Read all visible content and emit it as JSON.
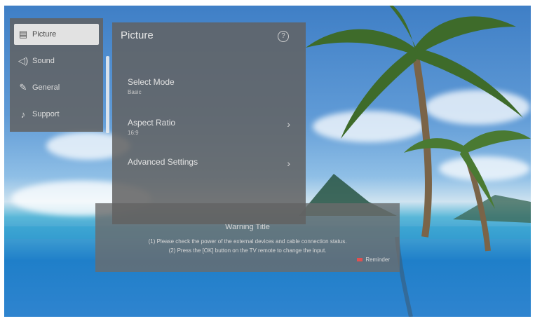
{
  "sidebar": {
    "items": [
      {
        "label": "Picture",
        "icon": "picture-icon",
        "glyph": "▤"
      },
      {
        "label": "Sound",
        "icon": "sound-icon",
        "glyph": "◁)"
      },
      {
        "label": "General",
        "icon": "wrench-icon",
        "glyph": "✎"
      },
      {
        "label": "Support",
        "icon": "headset-icon",
        "glyph": "♪"
      }
    ],
    "active_index": 0
  },
  "panel": {
    "title": "Picture",
    "help_glyph": "?",
    "rows": [
      {
        "label": "Select Mode",
        "value": "Basic"
      },
      {
        "label": "Aspect Ratio",
        "value": "16:9",
        "chevron": "›"
      },
      {
        "label": "Advanced Settings",
        "chevron": "›"
      }
    ]
  },
  "note": {
    "title": "Warning Title",
    "lines": [
      "(1) Please check the power of the external devices and cable connection status.",
      "(2) Press the [OK] button on the TV remote to change the input."
    ],
    "tag": "Reminder",
    "tag_color": "#e05050"
  }
}
